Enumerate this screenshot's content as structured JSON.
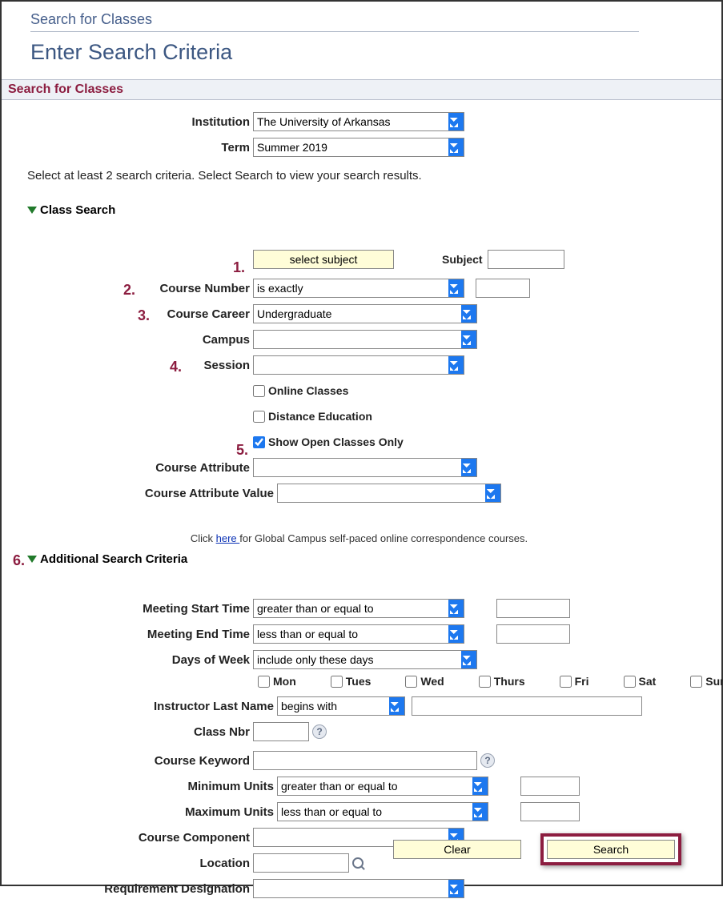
{
  "top_link": "Search for Classes",
  "heading": "Enter Search Criteria",
  "section_title": "Search for Classes",
  "labels": {
    "institution": "Institution",
    "term": "Term",
    "subject_right": "Subject",
    "course_number": "Course Number",
    "course_career": "Course Career",
    "campus": "Campus",
    "session": "Session",
    "online": "Online Classes",
    "distance": "Distance Education",
    "show_open": "Show Open Classes Only",
    "course_attr": "Course Attribute",
    "course_attr_val": "Course Attribute Value",
    "meeting_start": "Meeting Start Time",
    "meeting_end": "Meeting End Time",
    "days_of_week": "Days of Week",
    "instructor": "Instructor Last Name",
    "class_nbr": "Class Nbr",
    "course_keyword": "Course Keyword",
    "min_units": "Minimum Units",
    "max_units": "Maximum Units",
    "course_component": "Course Component",
    "location": "Location",
    "req_designation": "Requirement Designation"
  },
  "values": {
    "institution": "The University of Arkansas",
    "term": "Summer 2019",
    "select_subject_btn": "select subject",
    "course_number_op": "is exactly",
    "course_career": "Undergraduate",
    "meeting_start_op": "greater than or equal to",
    "meeting_end_op": "less than or equal to",
    "days_op": "include only these days",
    "instructor_op": "begins with",
    "min_units_op": "greater than or equal to",
    "max_units_op": "less than or equal to"
  },
  "instruction": "Select at least 2 search criteria. Select Search to view your search results.",
  "collapsibles": {
    "class_search": "Class Search",
    "additional": "Additional Search Criteria"
  },
  "markers": {
    "m1": "1.",
    "m2": "2.",
    "m3": "3.",
    "m4": "4.",
    "m5": "5.",
    "m6": "6."
  },
  "hint": {
    "pre": "Click ",
    "link": "here ",
    "post": "for Global Campus self-paced online correspondence courses."
  },
  "days": {
    "mon": "Mon",
    "tue": "Tues",
    "wed": "Wed",
    "thu": "Thurs",
    "fri": "Fri",
    "sat": "Sat",
    "sun": "Sun"
  },
  "buttons": {
    "clear": "Clear",
    "search": "Search"
  }
}
